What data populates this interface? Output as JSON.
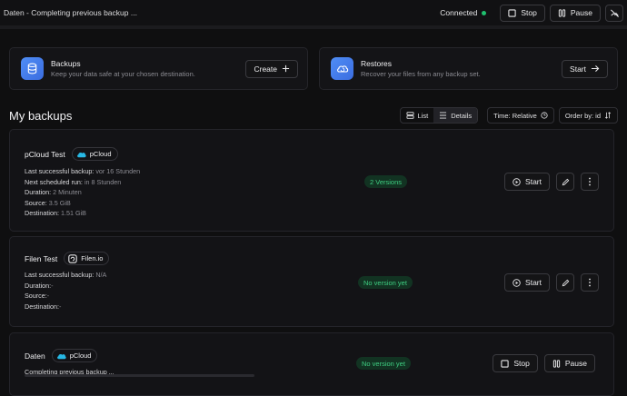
{
  "topbar": {
    "title": "Daten - Completing previous backup ...",
    "status": "Connected",
    "stop_label": "Stop",
    "pause_label": "Pause"
  },
  "cards": {
    "backups": {
      "title": "Backups",
      "subtitle": "Keep your data safe at your chosen destination.",
      "action": "Create"
    },
    "restores": {
      "title": "Restores",
      "subtitle": "Recover your files from any backup set.",
      "action": "Start"
    }
  },
  "section": {
    "title": "My backups",
    "view_list": "List",
    "view_details": "Details",
    "time_label": "Time: Relative",
    "order_label": "Order by: id"
  },
  "backups": [
    {
      "name": "pCloud Test",
      "provider": "pCloud",
      "rows": [
        {
          "label": "Last successful backup:",
          "value": "vor 16 Stunden"
        },
        {
          "label": "Next scheduled run:",
          "value": "in 8 Stunden"
        },
        {
          "label": "Duration:",
          "value": "2 Minuten"
        },
        {
          "label": "Source:",
          "value": "3.5 GiB"
        },
        {
          "label": "Destination:",
          "value": "1.51 GiB"
        }
      ],
      "badge": "2 Versions",
      "action": "Start"
    },
    {
      "name": "Filen Test",
      "provider": "Filen.io",
      "rows": [
        {
          "label": "Last successful backup:",
          "value": "N/A"
        },
        {
          "label": "Duration:",
          "value": "-"
        },
        {
          "label": "Source:",
          "value": "-"
        },
        {
          "label": "Destination:",
          "value": "-"
        }
      ],
      "badge": "No version yet",
      "action": "Start"
    },
    {
      "name": "Daten",
      "provider": "pCloud",
      "status": "Completing previous backup ...",
      "badge": "No version yet",
      "stop_label": "Stop",
      "pause_label": "Pause"
    }
  ],
  "colors": {
    "accent": "#4f8df5",
    "connected": "#1fbf6e",
    "badge_text": "#3fcf82",
    "badge_bg": "#123322"
  }
}
